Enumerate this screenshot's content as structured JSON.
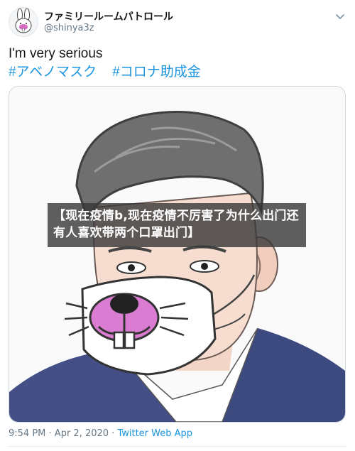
{
  "user": {
    "display_name": "ファミリールームパトロール",
    "handle": "@shinya3z",
    "avatar_icon": "rabbit-avatar-icon"
  },
  "tweet": {
    "text": "I'm very serious",
    "hashtags": [
      "#アベノマスク",
      "#コロナ助成金"
    ],
    "image_icon": "caricature-illustration"
  },
  "overlay": {
    "text": "【现在疫情b,现在疫情不厉害了为什么出门还有人喜欢带两个口罩出门】"
  },
  "footer": {
    "time": "9:54 PM",
    "separator": " · ",
    "date": "Apr 2, 2020",
    "source": "Twitter Web App"
  },
  "icons": {
    "more": "chevron-down-icon"
  },
  "colors": {
    "link": "#1b95e0",
    "muted": "#657786",
    "overlay_bg": "#373737"
  }
}
